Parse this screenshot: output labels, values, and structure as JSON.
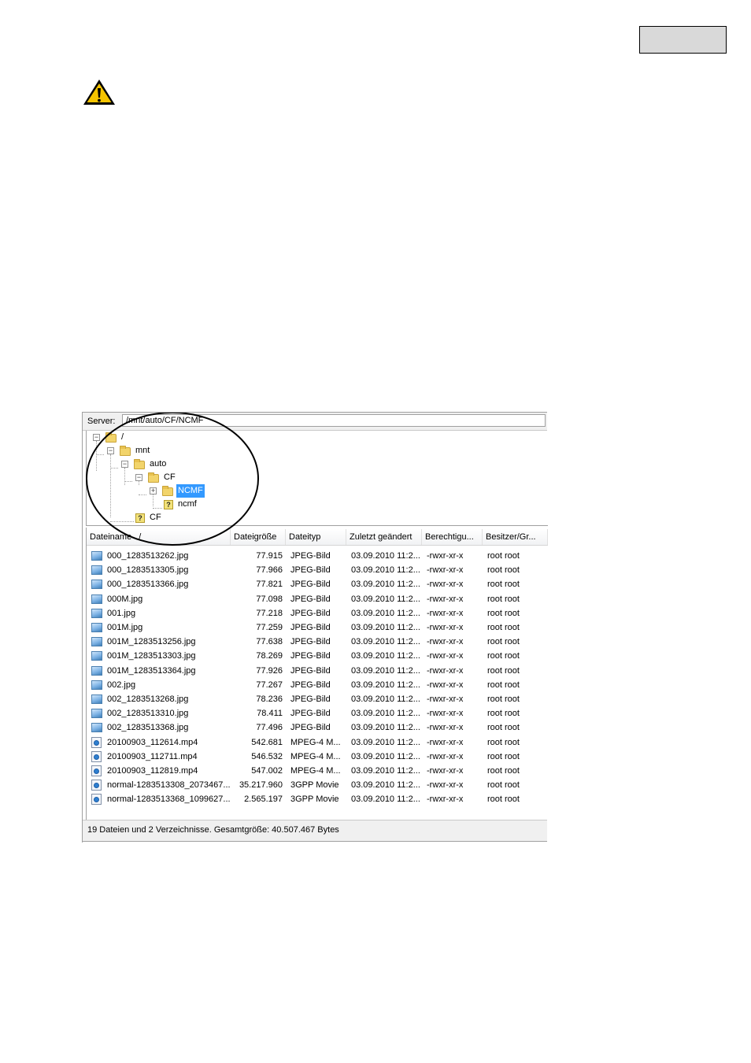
{
  "server": {
    "label": "Server:",
    "path": "/mnt/auto/CF/NCMF"
  },
  "tree": {
    "nodes": [
      {
        "label": "/",
        "icon": "folder-icon",
        "expander": "minus"
      },
      {
        "label": "mnt",
        "icon": "folder-icon",
        "expander": "minus"
      },
      {
        "label": "auto",
        "icon": "folder-icon",
        "expander": "minus"
      },
      {
        "label": "CF",
        "icon": "folder-icon",
        "expander": "minus"
      },
      {
        "label": "NCMF",
        "icon": "folder-icon",
        "expander": "plus",
        "selected": true
      },
      {
        "label": "ncmf",
        "icon": "unknown-folder-icon"
      },
      {
        "label": "CF",
        "icon": "unknown-folder-icon"
      }
    ]
  },
  "columns": [
    "Dateiname",
    "Dateigröße",
    "Dateityp",
    "Zuletzt geändert",
    "Berechtigu...",
    "Besitzer/Gr..."
  ],
  "files": [
    {
      "name": "000_1283513262.jpg",
      "size": "77.915",
      "type": "JPEG-Bild",
      "modified": "03.09.2010 11:2...",
      "perm": "-rwxr-xr-x",
      "owner": "root root",
      "icon": "image-file-icon"
    },
    {
      "name": "000_1283513305.jpg",
      "size": "77.966",
      "type": "JPEG-Bild",
      "modified": "03.09.2010 11:2...",
      "perm": "-rwxr-xr-x",
      "owner": "root root",
      "icon": "image-file-icon"
    },
    {
      "name": "000_1283513366.jpg",
      "size": "77.821",
      "type": "JPEG-Bild",
      "modified": "03.09.2010 11:2...",
      "perm": "-rwxr-xr-x",
      "owner": "root root",
      "icon": "image-file-icon"
    },
    {
      "name": "000M.jpg",
      "size": "77.098",
      "type": "JPEG-Bild",
      "modified": "03.09.2010 11:2...",
      "perm": "-rwxr-xr-x",
      "owner": "root root",
      "icon": "image-file-icon"
    },
    {
      "name": "001.jpg",
      "size": "77.218",
      "type": "JPEG-Bild",
      "modified": "03.09.2010 11:2...",
      "perm": "-rwxr-xr-x",
      "owner": "root root",
      "icon": "image-file-icon"
    },
    {
      "name": "001M.jpg",
      "size": "77.259",
      "type": "JPEG-Bild",
      "modified": "03.09.2010 11:2...",
      "perm": "-rwxr-xr-x",
      "owner": "root root",
      "icon": "image-file-icon"
    },
    {
      "name": "001M_1283513256.jpg",
      "size": "77.638",
      "type": "JPEG-Bild",
      "modified": "03.09.2010 11:2...",
      "perm": "-rwxr-xr-x",
      "owner": "root root",
      "icon": "image-file-icon"
    },
    {
      "name": "001M_1283513303.jpg",
      "size": "78.269",
      "type": "JPEG-Bild",
      "modified": "03.09.2010 11:2...",
      "perm": "-rwxr-xr-x",
      "owner": "root root",
      "icon": "image-file-icon"
    },
    {
      "name": "001M_1283513364.jpg",
      "size": "77.926",
      "type": "JPEG-Bild",
      "modified": "03.09.2010 11:2...",
      "perm": "-rwxr-xr-x",
      "owner": "root root",
      "icon": "image-file-icon"
    },
    {
      "name": "002.jpg",
      "size": "77.267",
      "type": "JPEG-Bild",
      "modified": "03.09.2010 11:2...",
      "perm": "-rwxr-xr-x",
      "owner": "root root",
      "icon": "image-file-icon"
    },
    {
      "name": "002_1283513268.jpg",
      "size": "78.236",
      "type": "JPEG-Bild",
      "modified": "03.09.2010 11:2...",
      "perm": "-rwxr-xr-x",
      "owner": "root root",
      "icon": "image-file-icon"
    },
    {
      "name": "002_1283513310.jpg",
      "size": "78.411",
      "type": "JPEG-Bild",
      "modified": "03.09.2010 11:2...",
      "perm": "-rwxr-xr-x",
      "owner": "root root",
      "icon": "image-file-icon"
    },
    {
      "name": "002_1283513368.jpg",
      "size": "77.496",
      "type": "JPEG-Bild",
      "modified": "03.09.2010 11:2...",
      "perm": "-rwxr-xr-x",
      "owner": "root root",
      "icon": "image-file-icon"
    },
    {
      "name": "20100903_112614.mp4",
      "size": "542.681",
      "type": "MPEG-4 M...",
      "modified": "03.09.2010 11:2...",
      "perm": "-rwxr-xr-x",
      "owner": "root root",
      "icon": "video-file-icon"
    },
    {
      "name": "20100903_112711.mp4",
      "size": "546.532",
      "type": "MPEG-4 M...",
      "modified": "03.09.2010 11:2...",
      "perm": "-rwxr-xr-x",
      "owner": "root root",
      "icon": "video-file-icon"
    },
    {
      "name": "20100903_112819.mp4",
      "size": "547.002",
      "type": "MPEG-4 M...",
      "modified": "03.09.2010 11:2...",
      "perm": "-rwxr-xr-x",
      "owner": "root root",
      "icon": "video-file-icon"
    },
    {
      "name": "normal-1283513308_2073467...",
      "size": "35.217.960",
      "type": "3GPP Movie",
      "modified": "03.09.2010 11:2...",
      "perm": "-rwxr-xr-x",
      "owner": "root root",
      "icon": "video-file-icon"
    },
    {
      "name": "normal-1283513368_1099627...",
      "size": "2.565.197",
      "type": "3GPP Movie",
      "modified": "03.09.2010 11:2...",
      "perm": "-rwxr-xr-x",
      "owner": "root root",
      "icon": "video-file-icon"
    }
  ],
  "sort_indicator": "/",
  "status": "19 Dateien und 2 Verzeichnisse. Gesamtgröße: 40.507.467 Bytes",
  "colors": {
    "selection": "#3399ff",
    "warning_fill": "#f5c400",
    "annotation": "#000000"
  }
}
